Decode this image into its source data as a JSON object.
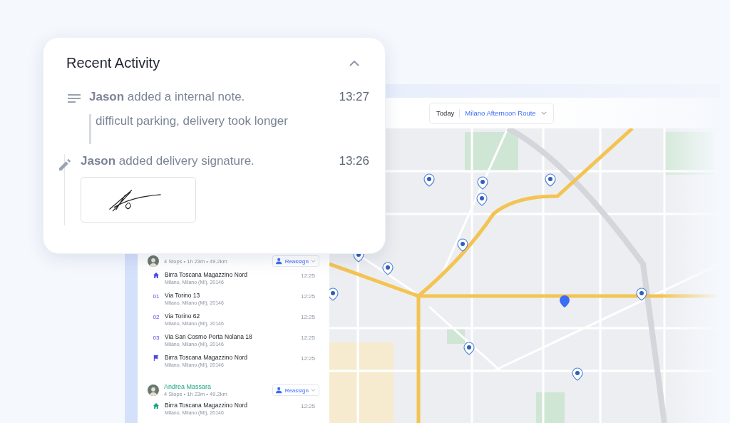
{
  "toolbar": {
    "date": "Today",
    "route": "Milano Afternoon Route"
  },
  "routes": [
    {
      "stats": "4 Stops • 1h 23m • 49.2km",
      "action": "Reassign",
      "color": "#4f46e5",
      "stops": [
        {
          "kind": "start",
          "name": "Birra Toscana Magazzino Nord",
          "address": "Milano, Milano (MI), 20146",
          "time": "12:25"
        },
        {
          "kind": "numbered",
          "number": "01",
          "name": "Via Torino 13",
          "address": "Milano, Milano (MI), 20146",
          "time": "12:25"
        },
        {
          "kind": "numbered",
          "number": "02",
          "name": "Via Torino 62",
          "address": "Milano, Milano (MI), 20146",
          "time": "12:25"
        },
        {
          "kind": "numbered",
          "number": "03",
          "name": "Via San Cosmo Porta Nolana 18",
          "address": "Milano, Milano (MI), 20146",
          "time": "12:25"
        },
        {
          "kind": "end",
          "name": "Birra Toscana Magazzino Nord",
          "address": "Milano, Milano (MI), 20146",
          "time": "12:25"
        }
      ]
    },
    {
      "driver": "Andrea Massara",
      "stats": "4 Stops • 1h 23m • 49.2km",
      "action": "Reassign",
      "color": "#16a37f",
      "stops": [
        {
          "kind": "start",
          "name": "Birra Toscana Magazzino Nord",
          "address": "Milano, Milano (MI), 20146",
          "time": "12:25"
        }
      ]
    }
  ],
  "activity": {
    "title": "Recent Activity",
    "expanded": true,
    "entries": [
      {
        "kind": "note",
        "text": "**Jason** added a internal note.",
        "time": "13:27",
        "note": "difficult parking, delivery took longer"
      },
      {
        "kind": "signature",
        "text": "**Jason** added delivery signature.",
        "time": "13:26"
      }
    ]
  }
}
